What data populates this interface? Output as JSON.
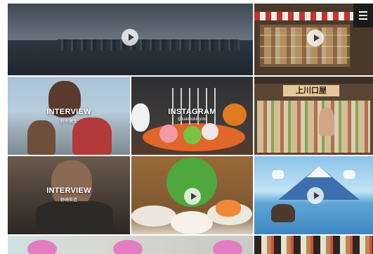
{
  "header": {
    "menu_icon": "hamburger-menu-icon"
  },
  "tiles": [
    {
      "name": "city-skyline-video",
      "kind": "video"
    },
    {
      "name": "candy-shop-video",
      "kind": "video"
    },
    {
      "name": "interview-family-tile",
      "kind": "interview",
      "title": "INTERVIEW",
      "subtitle": "鈴木健生"
    },
    {
      "name": "instagram-cakepops-tile",
      "kind": "instagram",
      "title": "INSTAGRAM",
      "subtitle": "@kakinokikyoto"
    },
    {
      "name": "storefront-tile",
      "kind": "photo",
      "sign_text": "上川口屋"
    },
    {
      "name": "interview-man-tile",
      "kind": "interview",
      "title": "INTERVIEW",
      "subtitle": "野崎荣造"
    },
    {
      "name": "green-mascot-video",
      "kind": "video"
    },
    {
      "name": "mount-fuji-video",
      "kind": "video"
    },
    {
      "name": "pink-birds-tile",
      "kind": "photo"
    },
    {
      "name": "masks-tile",
      "kind": "photo"
    }
  ]
}
